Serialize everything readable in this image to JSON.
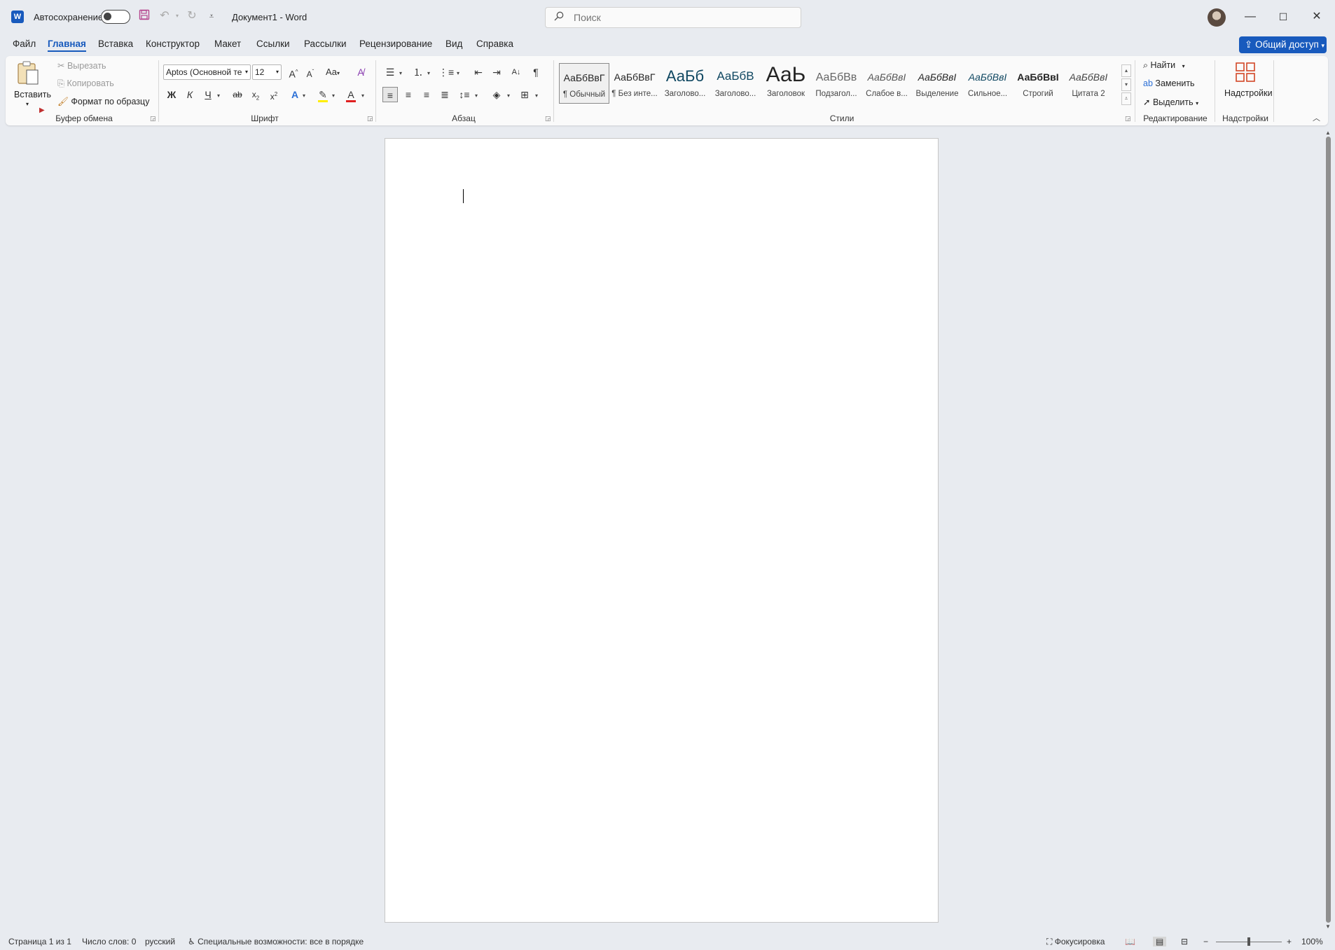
{
  "titlebar": {
    "autosave_label": "Автосохранение",
    "document_title": "Документ1  -  Word",
    "search_placeholder": "Поиск"
  },
  "tabs": [
    "Файл",
    "Главная",
    "Вставка",
    "Конструктор",
    "Макет",
    "Ссылки",
    "Рассылки",
    "Рецензирование",
    "Вид",
    "Справка"
  ],
  "active_tab": "Главная",
  "share_label": "Общий доступ",
  "ribbon": {
    "clipboard": {
      "paste": "Вставить",
      "cut": "Вырезать",
      "copy": "Копировать",
      "format_painter": "Формат по образцу",
      "group": "Буфер обмена"
    },
    "font": {
      "font_name": "Aptos (Основной те",
      "font_size": "12",
      "bold": "Ж",
      "italic": "К",
      "underline": "Ч",
      "strike": "ab",
      "group": "Шрифт"
    },
    "paragraph": {
      "group": "Абзац"
    },
    "styles": {
      "group": "Стили",
      "items": [
        {
          "preview": "АаБбВвГ",
          "name": "¶ Обычный"
        },
        {
          "preview": "АаБбВвГ",
          "name": "¶ Без инте..."
        },
        {
          "preview": "АаБб",
          "name": "Заголово..."
        },
        {
          "preview": "АаБбВ",
          "name": "Заголово..."
        },
        {
          "preview": "АаЬ",
          "name": "Заголовок"
        },
        {
          "preview": "АаБбВв",
          "name": "Подзагол..."
        },
        {
          "preview": "АаБбВвІ",
          "name": "Слабое в..."
        },
        {
          "preview": "АаБбВвІ",
          "name": "Выделение"
        },
        {
          "preview": "АаБбВвІ",
          "name": "Сильное..."
        },
        {
          "preview": "АаБбВвІ",
          "name": "Строгий"
        },
        {
          "preview": "АаБбВвІ",
          "name": "Цитата 2"
        }
      ]
    },
    "editing": {
      "find": "Найти",
      "replace": "Заменить",
      "select": "Выделить",
      "group": "Редактирование"
    },
    "addins": {
      "button": "Надстройки",
      "group": "Надстройки"
    }
  },
  "statusbar": {
    "page": "Страница 1 из 1",
    "words": "Число слов: 0",
    "language": "русский",
    "accessibility": "Специальные возможности: все в порядке",
    "focus": "Фокусировка",
    "zoom": "100%"
  },
  "colors": {
    "accent": "#185abd",
    "save_icon": "#b5478f",
    "highlight": "#ffee00",
    "font_color": "#e02020"
  }
}
